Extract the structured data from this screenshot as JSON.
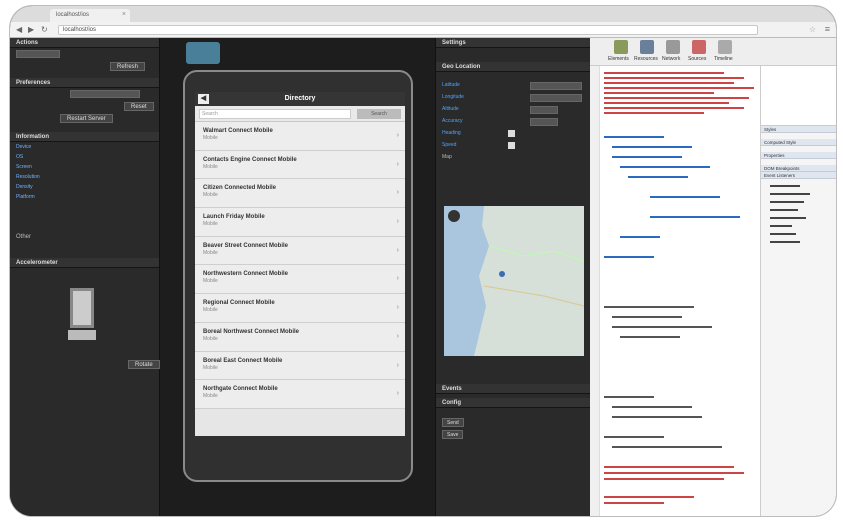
{
  "browser": {
    "tab_title": "localhost/ios",
    "url": "localhost/ios"
  },
  "left_panel": {
    "sections": [
      "Actions",
      "Preferences",
      "Information",
      "Accelerometer"
    ],
    "action_button": "Refresh",
    "pref_button": "Restart Server",
    "reset_button": "Reset",
    "info_items": [
      "Device",
      "OS",
      "Screen",
      "Resolution",
      "Density",
      "Platform"
    ],
    "other_label": "Other",
    "orientation_button": "Rotate"
  },
  "center": {
    "list_title": "Directory",
    "search_placeholder": "Search",
    "search_button": "Search",
    "items": [
      {
        "title": "Walmart Connect Mobile",
        "sub": "Mobile"
      },
      {
        "title": "Contacts Engine Connect Mobile",
        "sub": "Mobile"
      },
      {
        "title": "Citizen Connected Mobile",
        "sub": "Mobile"
      },
      {
        "title": "Launch Friday Mobile",
        "sub": "Mobile"
      },
      {
        "title": "Beaver Street Connect Mobile",
        "sub": "Mobile"
      },
      {
        "title": "Northwestern Connect Mobile",
        "sub": "Mobile"
      },
      {
        "title": "Regional Connect Mobile",
        "sub": "Mobile"
      },
      {
        "title": "Boreal Northwest Connect Mobile",
        "sub": "Mobile"
      },
      {
        "title": "Boreal East Connect Mobile",
        "sub": "Mobile"
      },
      {
        "title": "Northgate Connect Mobile",
        "sub": "Mobile"
      }
    ]
  },
  "right_panel": {
    "sections": [
      "Settings",
      "Geo Location",
      "Events",
      "Config"
    ],
    "fields": [
      "Latitude",
      "Longitude",
      "Altitude",
      "Accuracy",
      "Heading",
      "Speed"
    ],
    "map_label": "Map",
    "event_button": "Send",
    "config_button": "Save"
  },
  "devtools": {
    "toolbar": [
      "Elements",
      "Resources",
      "Network",
      "Sources",
      "Timeline"
    ],
    "side_headers": [
      "Styles",
      "Computed Style",
      "Properties",
      "DOM Breakpoints",
      "Event Listeners"
    ]
  }
}
